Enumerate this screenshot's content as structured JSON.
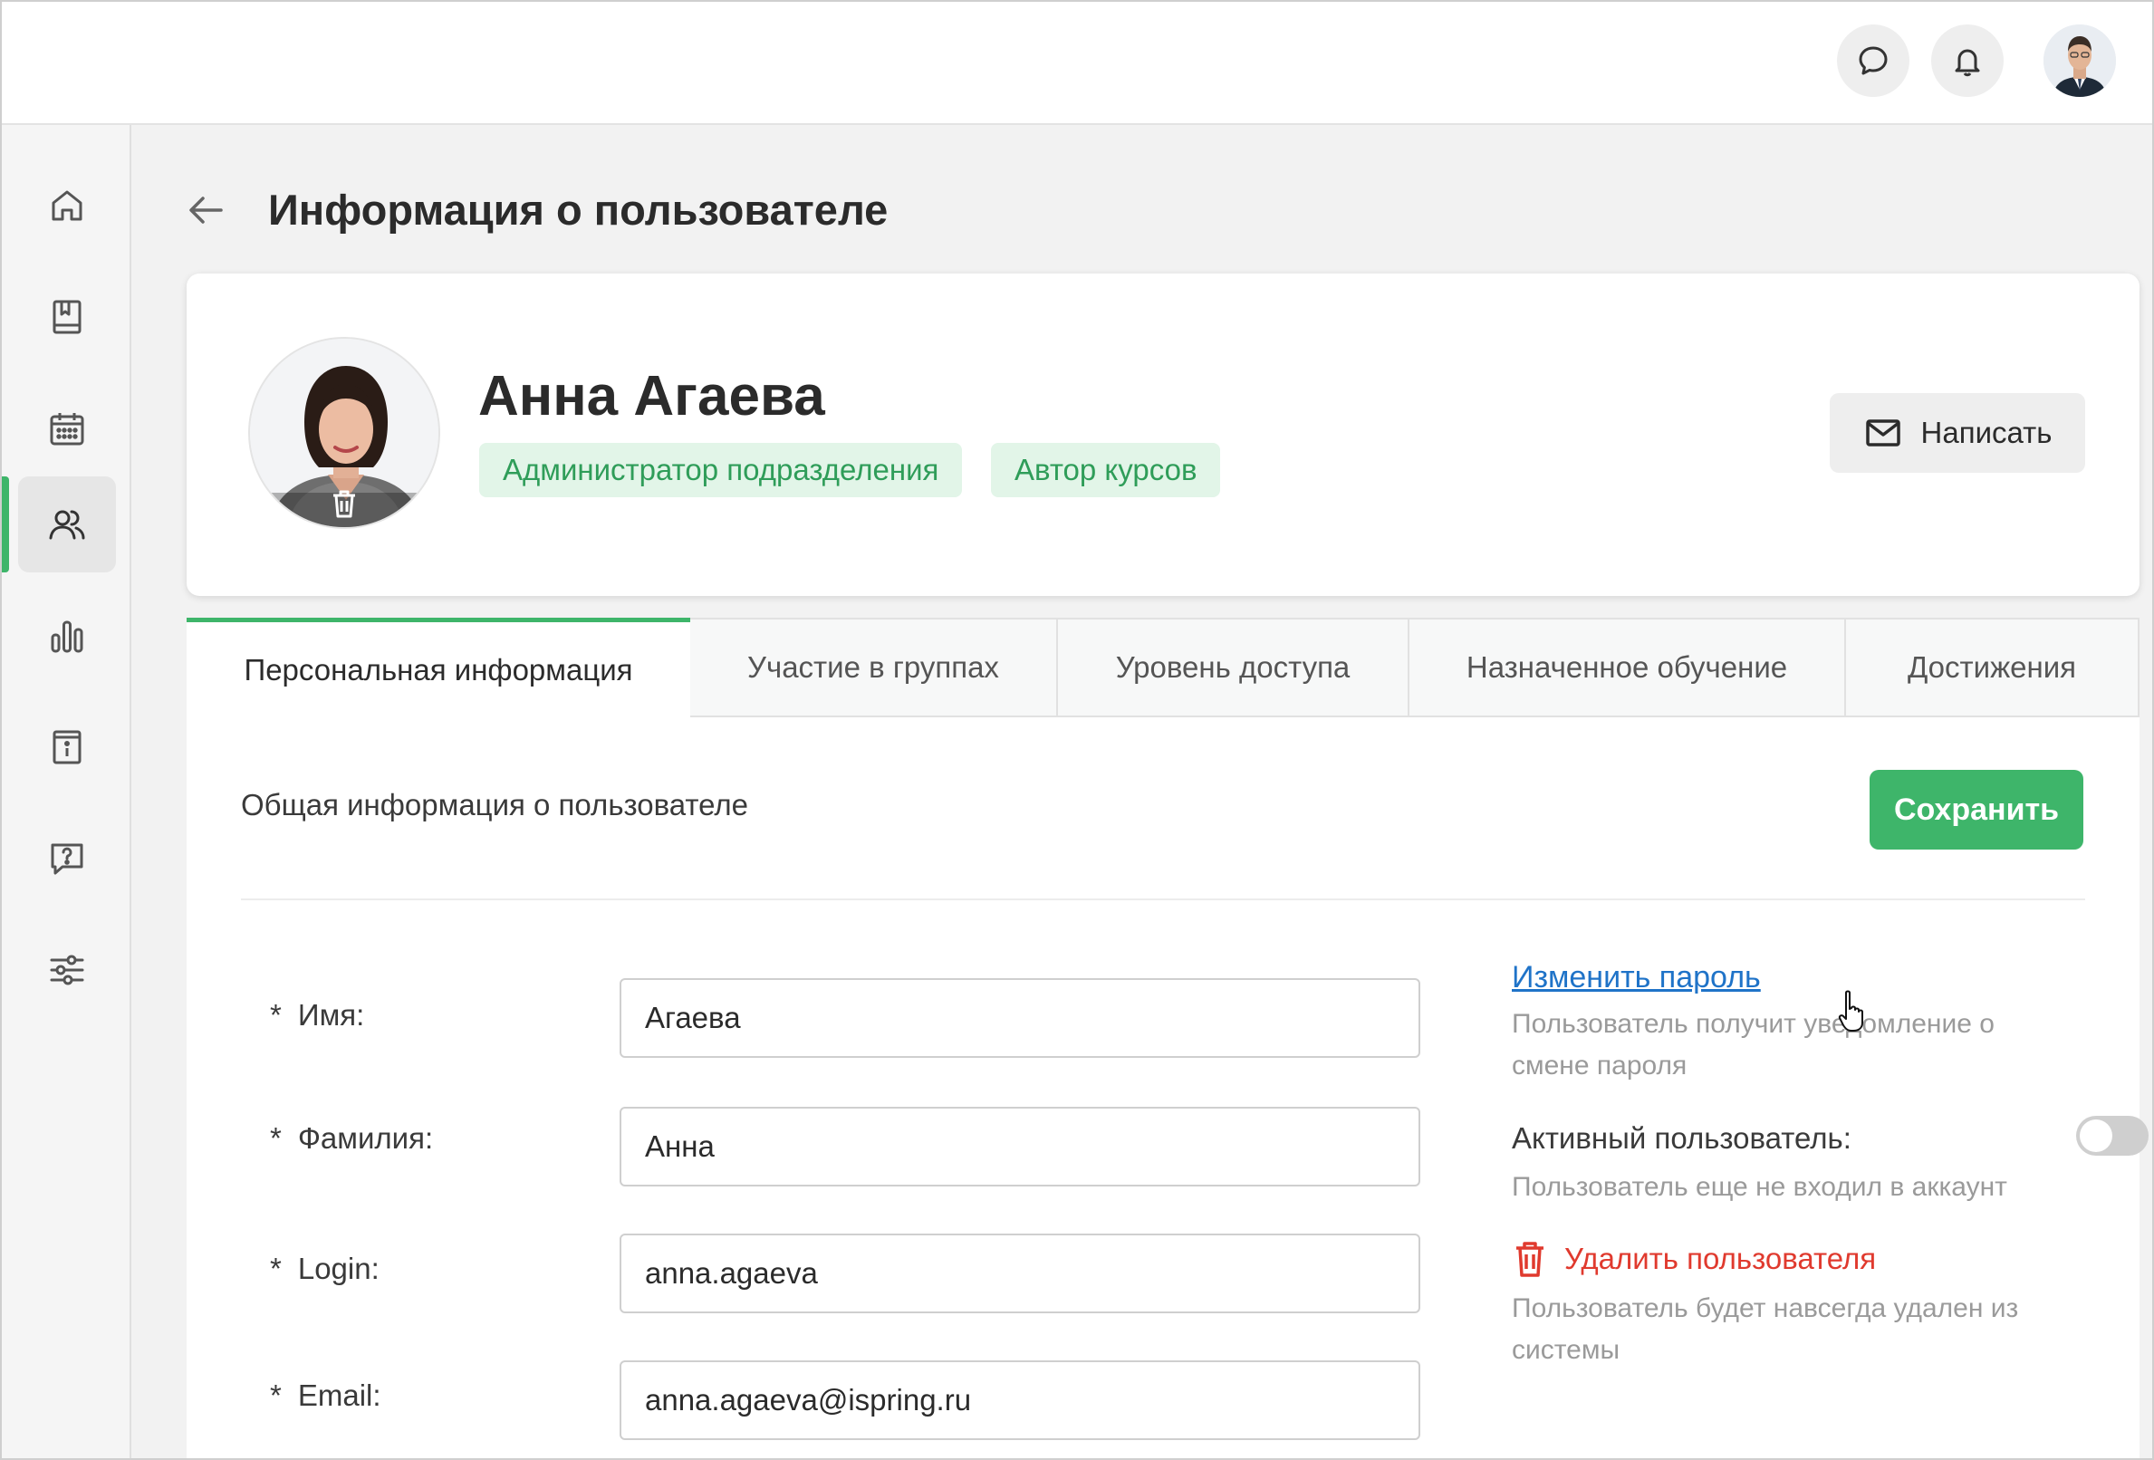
{
  "header": {
    "messages_icon": "chat-bubble-icon",
    "notifications_icon": "bell-icon"
  },
  "sidebar": {
    "items": [
      {
        "name": "home",
        "icon": "home-icon"
      },
      {
        "name": "courses",
        "icon": "book-icon"
      },
      {
        "name": "calendar",
        "icon": "calendar-icon"
      },
      {
        "name": "users",
        "icon": "users-icon",
        "active": true
      },
      {
        "name": "reports",
        "icon": "bar-chart-icon"
      },
      {
        "name": "info",
        "icon": "info-book-icon"
      },
      {
        "name": "help",
        "icon": "question-chat-icon"
      },
      {
        "name": "settings",
        "icon": "sliders-icon"
      }
    ]
  },
  "page": {
    "title": "Информация о пользователе"
  },
  "profile": {
    "name": "Анна Агаева",
    "roles": [
      "Администратор подразделения",
      "Автор курсов"
    ],
    "write_label": "Написать"
  },
  "tabs": [
    {
      "label": "Персональная информация",
      "active": true
    },
    {
      "label": "Участие в группах"
    },
    {
      "label": "Уровень доступа"
    },
    {
      "label": "Назначенное обучение"
    },
    {
      "label": "Достижения"
    }
  ],
  "form": {
    "section_title": "Общая информация о пользователе",
    "save_label": "Сохранить",
    "fields": [
      {
        "label": "Имя:",
        "value": "Агаева"
      },
      {
        "label": "Фамилия:",
        "value": "Анна"
      },
      {
        "label": "Login:",
        "value": "anna.agaeva"
      },
      {
        "label": "Email:",
        "value": "anna.agaeva@ispring.ru"
      }
    ],
    "required_mark": "*"
  },
  "side_actions": {
    "change_password": "Изменить пароль",
    "change_password_hint": "Пользователь получит уведомление о смене пароля",
    "active_label": "Активный пользователь:",
    "active_state": false,
    "active_hint": "Пользователь еще не входил в аккаунт",
    "delete_label": "Удалить пользователя",
    "delete_hint": "Пользователь будет навсегда удален из системы"
  },
  "colors": {
    "accent": "#3eb56a",
    "badge_bg": "#e2f5e8",
    "badge_text": "#2f9d59",
    "link": "#1f73c8",
    "danger": "#e03a2e"
  }
}
